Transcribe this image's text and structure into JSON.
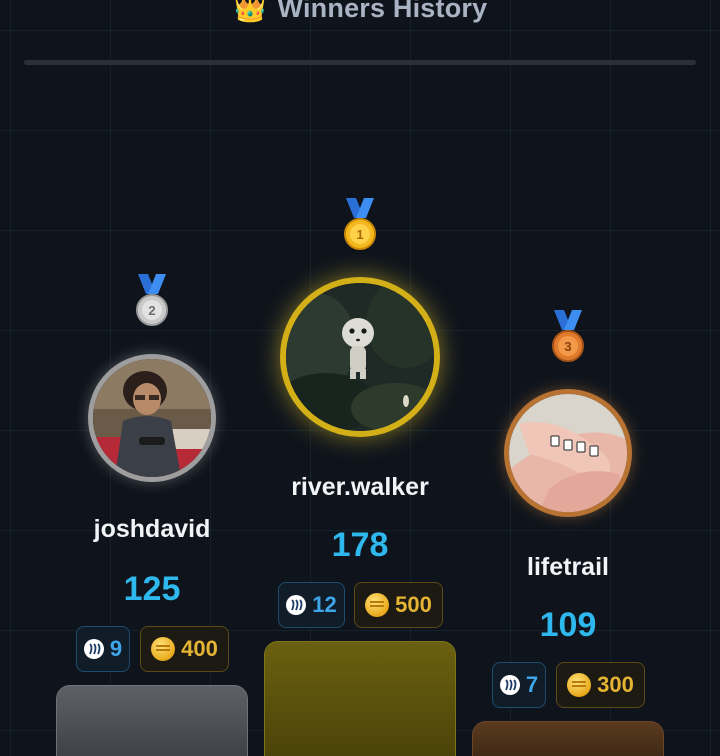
{
  "header": {
    "crown_icon": "👑",
    "title": "Winners History"
  },
  "colors": {
    "background": "#0f141c",
    "score": "#2fb8ee",
    "steem_text": "#3ea6e8",
    "coin_text": "#e6b434",
    "gold": "#d4b018",
    "silver": "#9a9a9a",
    "bronze": "#b87333"
  },
  "winners": [
    {
      "rank": 2,
      "medal": "silver-medal-icon",
      "name": "joshdavid",
      "score": "125",
      "steem": "9",
      "coins": "400"
    },
    {
      "rank": 1,
      "medal": "gold-medal-icon",
      "name": "river.walker",
      "score": "178",
      "steem": "12",
      "coins": "500"
    },
    {
      "rank": 3,
      "medal": "bronze-medal-icon",
      "name": "lifetrail",
      "score": "109",
      "steem": "7",
      "coins": "300"
    }
  ]
}
